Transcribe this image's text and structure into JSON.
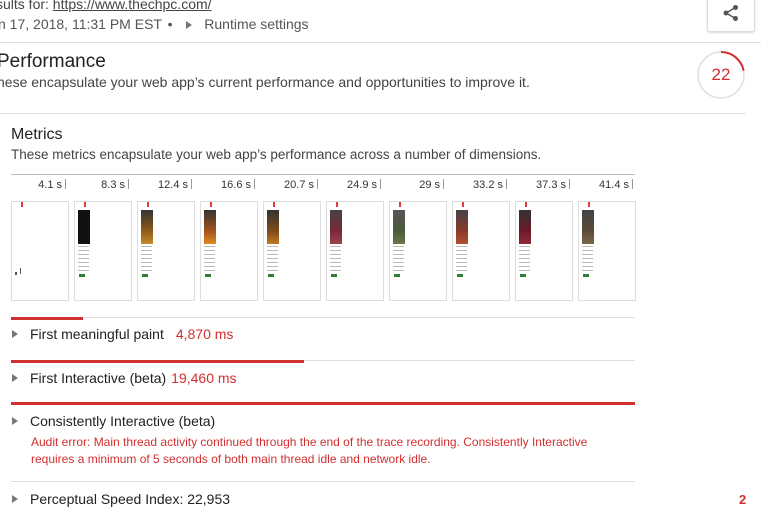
{
  "header": {
    "results_prefix": "sults for: ",
    "url": "https://www.thechpc.com/",
    "datetime": "n 17, 2018, 11:31 PM EST",
    "separator": "•",
    "runtime_settings": "Runtime settings"
  },
  "performance": {
    "title": "Performance",
    "description": "hese encapsulate your web app’s current performance and opportunities to improve it.",
    "score": "22",
    "score_fraction": 0.22,
    "score_color": "#d32f2f"
  },
  "metrics": {
    "title": "Metrics",
    "description": "These metrics encapsulate your web app’s performance across a number of dimensions.",
    "filmstrip_times": [
      "4.1 s",
      "8.3 s",
      "12.4 s",
      "16.6 s",
      "20.7 s",
      "24.9 s",
      "29 s",
      "33.2 s",
      "37.3 s",
      "41.4 s"
    ]
  },
  "audits": [
    {
      "label": "First meaningful paint",
      "value": "4,870 ms"
    },
    {
      "label": "First Interactive (beta)",
      "value": "19,460 ms"
    },
    {
      "label": "Consistently Interactive (beta)",
      "error": "Audit error: Main thread activity continued through the end of the trace recording. Consistently Interactive requires a minimum of 5 seconds of both main thread idle and network idle."
    },
    {
      "label": "Perceptual Speed Index: 22,953",
      "score_edge": "2"
    }
  ]
}
